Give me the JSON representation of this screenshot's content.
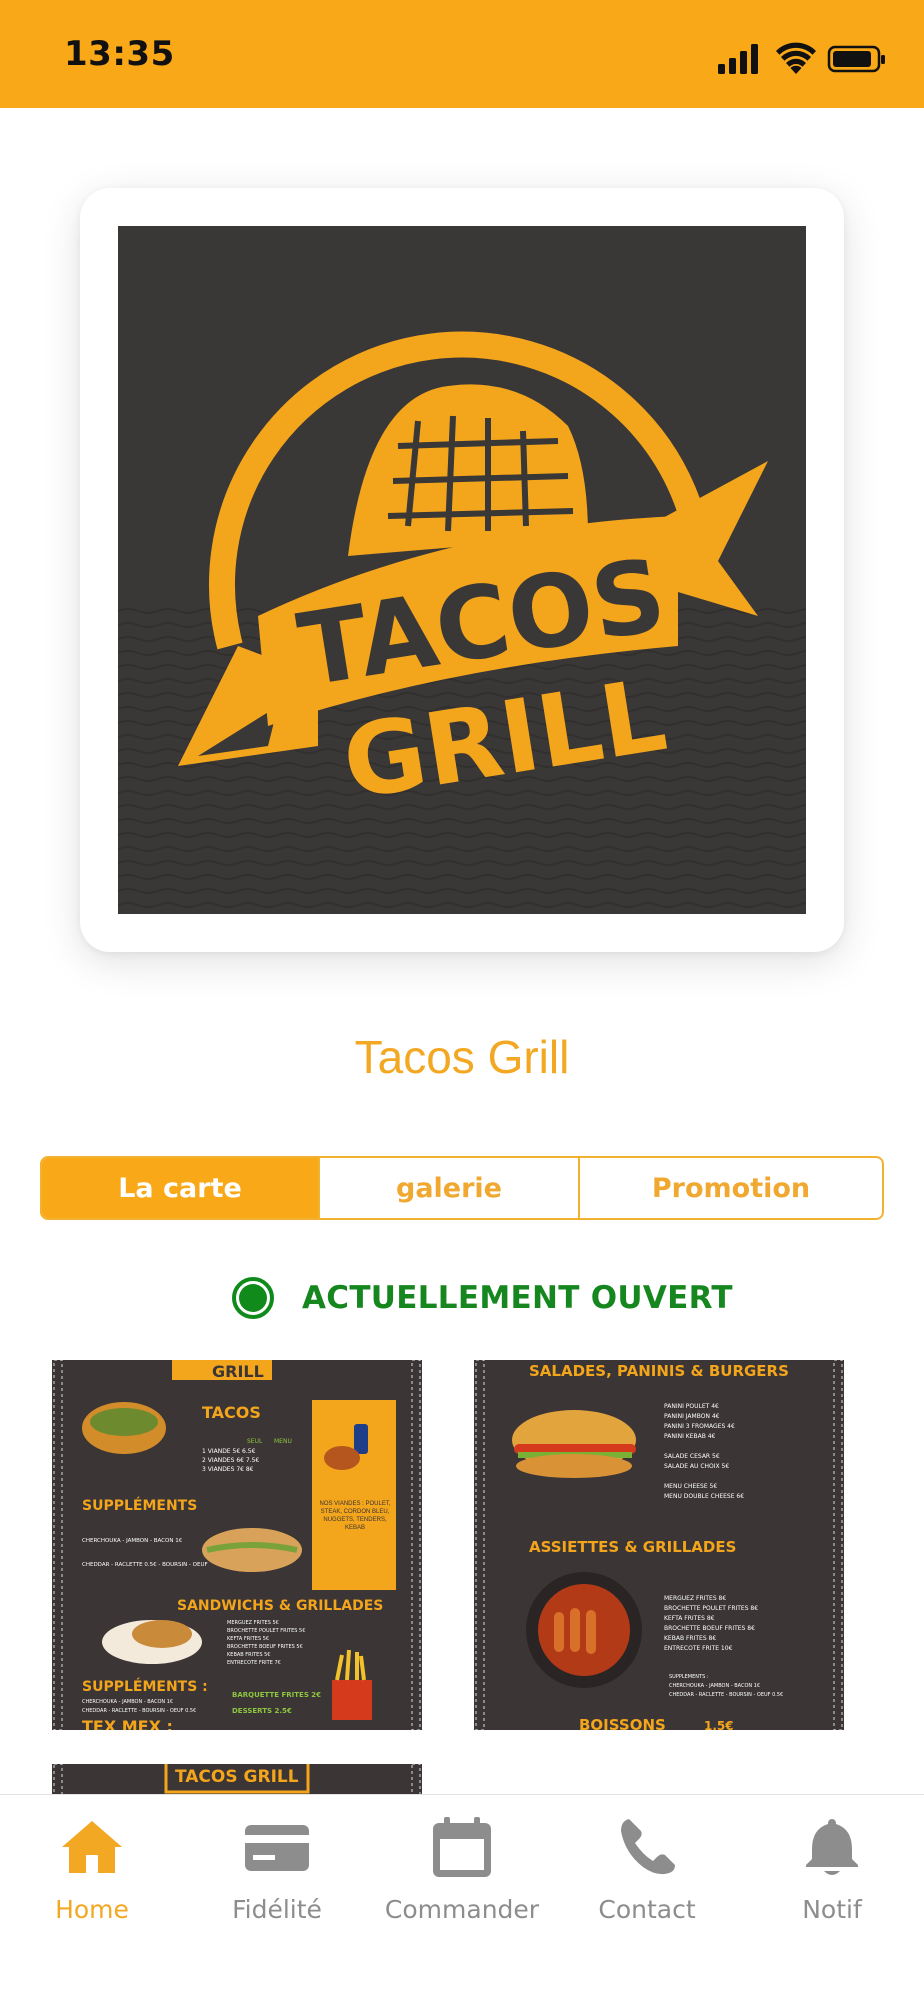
{
  "status_bar": {
    "time": "13:35"
  },
  "restaurant": {
    "name": "Tacos Grill",
    "logo_text_line1": "TACOS",
    "logo_text_line2": "GRILL"
  },
  "tabs": [
    {
      "label": "La carte",
      "active": true
    },
    {
      "label": "galerie",
      "active": false
    },
    {
      "label": "Promotion",
      "active": false
    }
  ],
  "open_status": {
    "label": "ACTUELLEMENT OUVERT"
  },
  "menu_images": [
    {
      "header": "GRILL",
      "title": "TACOS",
      "col_headers": [
        "SEUL",
        "MENU"
      ],
      "rows": [
        "1 VIANDE  5€  6.5€",
        "2 VIANDES  6€  7.5€",
        "3 VIANDES  7€  8€"
      ],
      "side_note": "NOS VIANDES : POULET, STEAK, CORDON BLEU, NUGGETS, TENDERS, KEBAB",
      "section2": "SUPPLÉMENTS",
      "supp_items": [
        "CHERCHOUKA - JAMBON - BACON  1€",
        "CHEDDAR - RACLETTE  0.5€ - BOURSIN - OEUF"
      ],
      "section3": "SANDWICHS & GRILLADES",
      "sandwich_items": [
        "MERGUEZ FRITES  5€",
        "BROCHETTE POULET FRITES  5€",
        "KEFTA FRITES  5€",
        "BROCHETTE BOEUF FRITES  5€",
        "KEBAB FRITES  5€",
        "ENTRECOTE FRITE  7€"
      ],
      "section4": "SUPPLÉMENTS :",
      "footer_items": [
        "CHERCHOUKA - JAMBON - BACON  1€",
        "CHEDDAR - RACLETTE - BOURSIN - OEUF  0.5€"
      ],
      "barquette": "BARQUETTE FRITES  2€",
      "desserts": "DESSERTS  2.5€",
      "texmex": "TEX MEX :"
    },
    {
      "title": "SALADES, PANINIS & BURGERS",
      "items": [
        "PANINI POULET  4€",
        "PANINI JAMBON  4€",
        "PANINI 3 FROMAGES  4€",
        "PANINI KEBAB  4€",
        "SALADE CESAR  5€",
        "SALADE AU CHOIX  5€",
        "MENU CHEESE  5€",
        "MENU DOUBLE CHEESE  6€"
      ],
      "section2": "ASSIETTES & GRILLADES",
      "items2": [
        "MERGUEZ FRITES  8€",
        "BROCHETTE POULET FRITES  8€",
        "KEFTA FRITES  8€",
        "BROCHETTE BOEUF FRITES  8€",
        "KEBAB FRITES  8€",
        "ENTRECOTE FRITE  10€"
      ],
      "supp": [
        "SUPPLEMENTS :",
        "CHERCHOUKA - JAMBON - BACON  1€",
        "CHEDDAR - RACLETTE - BOURSIN - OEUF  0.5€"
      ],
      "section3": "BOISSONS",
      "price3": "1.5€"
    },
    {
      "header": "TACOS GRILL"
    }
  ],
  "bottom_nav": [
    {
      "label": "Home",
      "icon": "home-icon",
      "active": true
    },
    {
      "label": "Fidélité",
      "icon": "card-icon",
      "active": false
    },
    {
      "label": "Commander",
      "icon": "calendar-icon",
      "active": false
    },
    {
      "label": "Contact",
      "icon": "phone-icon",
      "active": false
    },
    {
      "label": "Notif",
      "icon": "bell-icon",
      "active": false
    }
  ],
  "colors": {
    "accent": "#f9a818",
    "open_green": "#16861f",
    "inactive": "#8d8d8d",
    "logo_bg": "#3a3737"
  }
}
